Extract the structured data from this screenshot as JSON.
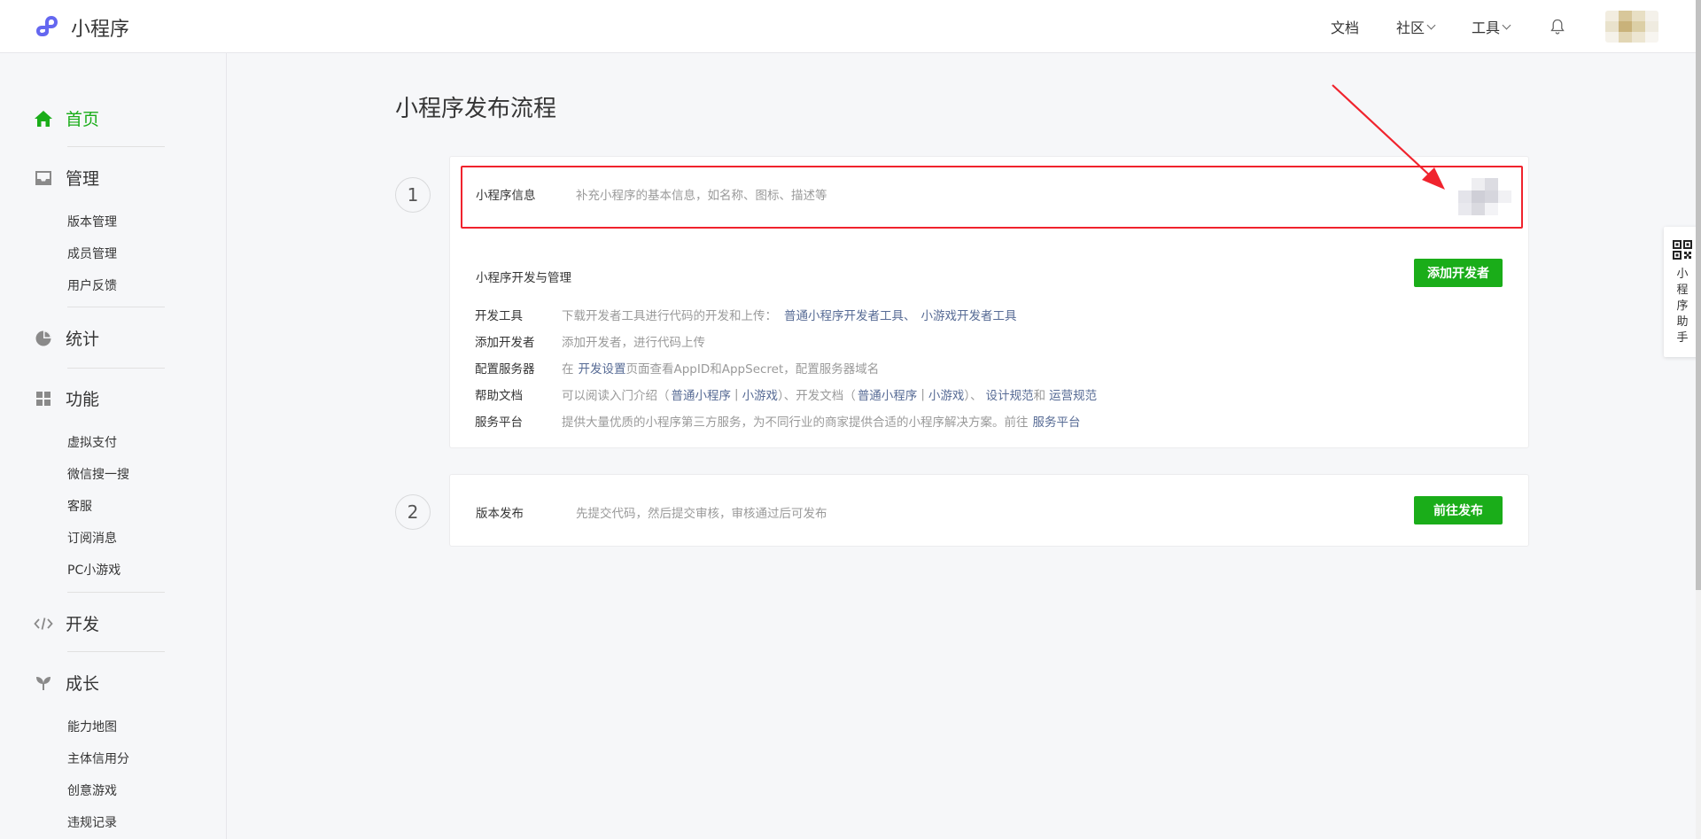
{
  "header": {
    "logo_text": "小程序",
    "nav": [
      {
        "label": "文档",
        "has_dropdown": false
      },
      {
        "label": "社区",
        "has_dropdown": true
      },
      {
        "label": "工具",
        "has_dropdown": true
      }
    ],
    "bell_icon": "bell-icon",
    "avatar": "avatar-blurred"
  },
  "sidebar": {
    "home": "首页",
    "manage": "管理",
    "manage_items": [
      "版本管理",
      "成员管理",
      "用户反馈"
    ],
    "stats": "统计",
    "features": "功能",
    "feature_items": [
      "虚拟支付",
      "微信搜一搜",
      "客服",
      "订阅消息",
      "PC小游戏"
    ],
    "develop": "开发",
    "growth": "成长",
    "growth_items": [
      "能力地图",
      "主体信用分",
      "创意游戏",
      "违规记录"
    ]
  },
  "main": {
    "title": "小程序发布流程",
    "step1": {
      "number": "1",
      "info_title": "小程序信息",
      "info_desc": "补充小程序的基本信息，如名称、图标、描述等",
      "dev_title": "小程序开发与管理",
      "add_dev_button": "添加开发者",
      "rows": {
        "tools": {
          "key": "开发工具",
          "text": "下载开发者工具进行代码的开发和上传：",
          "link1": "普通小程序开发者工具",
          "sep": "、",
          "link2": "小游戏开发者工具"
        },
        "add_dev": {
          "key": "添加开发者",
          "text": "添加开发者，进行代码上传"
        },
        "server": {
          "key": "配置服务器",
          "prefix": "在",
          "link": "开发设置",
          "suffix": "页面查看AppID和AppSecret，配置服务器域名"
        },
        "docs": {
          "key": "帮助文档",
          "t1": "可以阅读入门介绍（",
          "l1": "普通小程序",
          "bar1": "|",
          "l2": "小游戏",
          "t2": "）、开发文档（",
          "l3": "普通小程序",
          "bar2": "|",
          "l4": "小游戏",
          "t3": "）、",
          "l5": "设计规范",
          "t4": "和",
          "l6": "运营规范"
        },
        "platform": {
          "key": "服务平台",
          "text": "提供大量优质的小程序第三方服务，为不同行业的商家提供合适的小程序解决方案。前往",
          "link": "服务平台"
        }
      }
    },
    "step2": {
      "number": "2",
      "title": "版本发布",
      "desc": "先提交代码，然后提交审核，审核通过后可发布",
      "button": "前往发布"
    }
  },
  "helper": {
    "qr_icon": "qrcode-icon",
    "label": "小程序助手"
  },
  "colors": {
    "brand_green": "#1aad19",
    "link": "#576b95",
    "highlight": "#f0232d",
    "muted": "#9a9a9a"
  }
}
